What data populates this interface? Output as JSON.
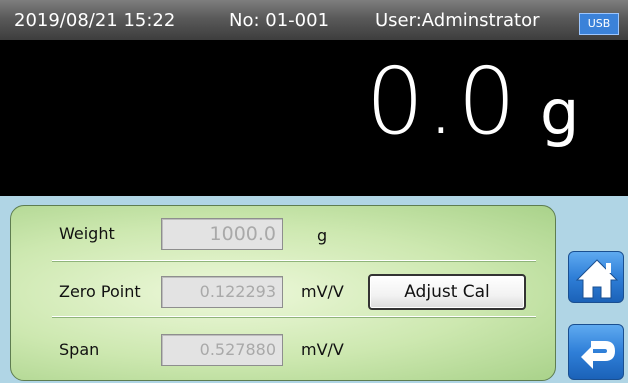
{
  "status": {
    "datetime": "2019/08/21 15:22",
    "number": "No: 01-001",
    "user": "User:Adminstrator",
    "usb_label": "USB"
  },
  "display": {
    "weight_value": "0.0",
    "weight_unit": "g"
  },
  "calibration": {
    "weight": {
      "label": "Weight",
      "value": "1000.0",
      "unit": "g"
    },
    "zero_point": {
      "label": "Zero Point",
      "value": "0.122293",
      "unit": "mV/V"
    },
    "span": {
      "label": "Span",
      "value": "0.527880",
      "unit": "mV/V"
    },
    "adjust_button_label": "Adjust Cal"
  },
  "nav": {
    "home_icon": "home-icon",
    "back_icon": "return-arrow-icon"
  },
  "colors": {
    "status_bar": "#5a5a5a",
    "display_bg": "#000000",
    "content_bg": "#b0d5e5",
    "panel_green": "#cde8b0",
    "button_blue": "#2f7fd8",
    "usb_badge": "#3b82d9"
  }
}
